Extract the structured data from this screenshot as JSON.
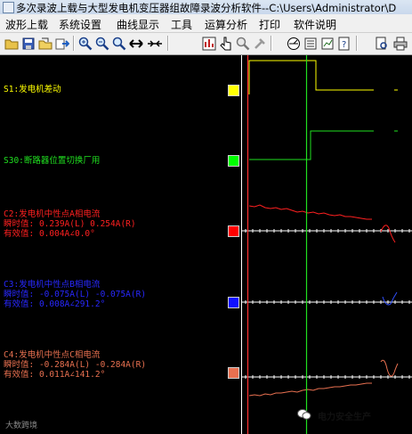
{
  "window": {
    "title": "多次录波上载与大型发电机变压器组故障录波分析软件--C:\\Users\\Administrator\\D"
  },
  "menu": [
    "波形上载",
    "系统设置",
    "曲线显示",
    "工具",
    "运算分析",
    "打印",
    "软件说明"
  ],
  "toolbar": {
    "icons": [
      "open-folder-icon",
      "save-icon",
      "open-file-icon",
      "export-icon",
      "zoom-in-icon",
      "zoom-out-icon",
      "zoom-icon",
      "expand-horizontal-icon",
      "compress-horizontal-icon",
      "report-icon",
      "cursor-hand-icon",
      "magnifier-icon",
      "settings-icon",
      "vector-icon",
      "list-icon",
      "chart-icon",
      "help-icon",
      "print-preview-icon",
      "print-icon"
    ]
  },
  "colors": {
    "background": "#000000",
    "s1": "#ffff00",
    "s30": "#00ff00",
    "c2": "#ff2020",
    "c3": "#2828ff",
    "c4": "#e87050",
    "cursor_red": "#ff3030",
    "cursor_green": "#20e020"
  },
  "channels": {
    "s1": {
      "name": "S1:发电机差动"
    },
    "s30": {
      "name": "S30:断路器位置切换厂用"
    },
    "c2": {
      "name": "C2:发电机中性点A相电流",
      "inst": "瞬时值: 0.239A(L) 0.254A(R)",
      "rms": "有效值: 0.004A∠0.0°"
    },
    "c3": {
      "name": "C3:发电机中性点B相电流",
      "inst": "瞬时值: -0.075A(L) -0.075A(R)",
      "rms": "有效值: 0.008A∠291.2°"
    },
    "c4": {
      "name": "C4:发电机中性点C相电流",
      "inst": "瞬时值: -0.284A(L) -0.284A(R)",
      "rms": "有效值: 0.011A∠141.2°"
    }
  },
  "watermarks": {
    "left": "大数跨境",
    "right": "电力安全生产"
  }
}
